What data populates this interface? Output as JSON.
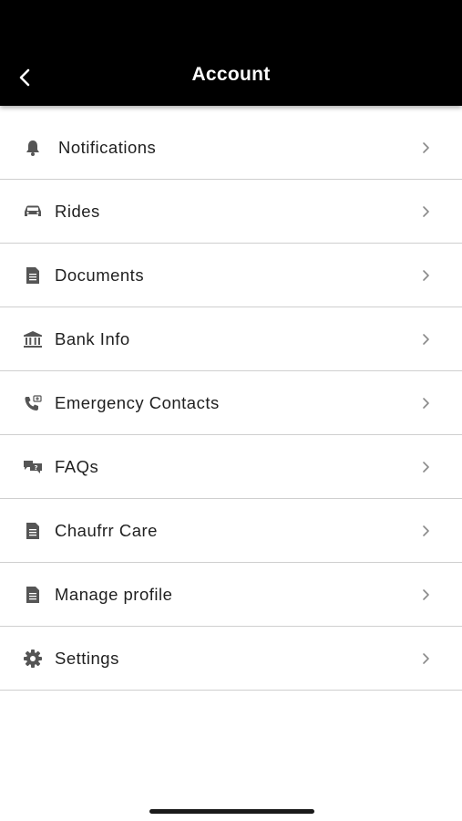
{
  "header": {
    "title": "Account",
    "back_icon": "chevron-left-icon",
    "background": "#000000"
  },
  "menu": [
    {
      "label": "Notifications",
      "icon": "bell-icon"
    },
    {
      "label": "Rides",
      "icon": "car-icon"
    },
    {
      "label": "Documents",
      "icon": "document-icon"
    },
    {
      "label": "Bank Info",
      "icon": "bank-icon"
    },
    {
      "label": "Emergency Contacts",
      "icon": "emergency-phone-icon"
    },
    {
      "label": "FAQs",
      "icon": "faq-chat-icon"
    },
    {
      "label": "Chaufrr Care",
      "icon": "document-icon"
    },
    {
      "label": "Manage profile",
      "icon": "document-icon"
    },
    {
      "label": "Settings",
      "icon": "gear-icon"
    }
  ]
}
